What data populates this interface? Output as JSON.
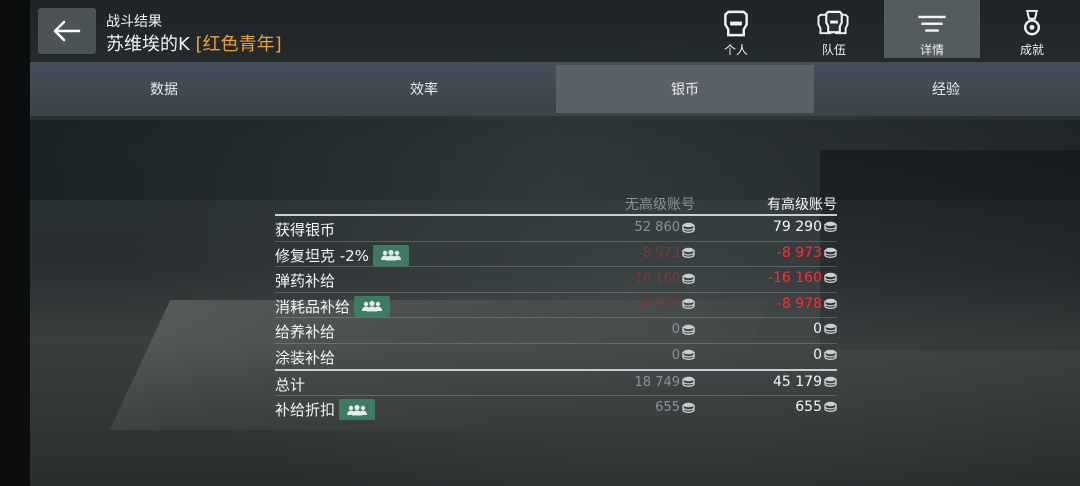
{
  "header": {
    "subtitle": "战斗结果",
    "player_name": "苏维埃的K",
    "clan_tag": "[红色青年]"
  },
  "topnav": [
    {
      "label": "个人",
      "icon": "player-helmet-icon",
      "active": false
    },
    {
      "label": "队伍",
      "icon": "team-helmets-icon",
      "active": false
    },
    {
      "label": "详情",
      "icon": "details-lines-icon",
      "active": true
    },
    {
      "label": "成就",
      "icon": "medal-icon",
      "active": false
    }
  ],
  "tabs": [
    {
      "label": "数据",
      "active": false
    },
    {
      "label": "效率",
      "active": false
    },
    {
      "label": "银币",
      "active": true
    },
    {
      "label": "经验",
      "active": false
    }
  ],
  "table": {
    "col_without_premium": "无高级账号",
    "col_with_premium": "有高级账号",
    "rows": [
      {
        "label": "获得银币",
        "without": "52 860",
        "with": "79 290",
        "negative": false,
        "squad": false
      },
      {
        "label": "修复坦克 -2%",
        "without": "-8 973",
        "with": "-8 973",
        "negative": true,
        "squad": true
      },
      {
        "label": "弹药补给",
        "without": "-16 160",
        "with": "-16 160",
        "negative": true,
        "squad": false
      },
      {
        "label": "消耗品补给",
        "without": "-8 978",
        "with": "-8 978",
        "negative": true,
        "squad": true
      },
      {
        "label": "给养补给",
        "without": "0",
        "with": "0",
        "negative": false,
        "squad": false
      },
      {
        "label": "涂装补给",
        "without": "0",
        "with": "0",
        "negative": false,
        "squad": false
      }
    ],
    "totals": [
      {
        "label": "总计",
        "without": "18 749",
        "with": "45 179",
        "squad": false
      },
      {
        "label": "补给折扣",
        "without": "655",
        "with": "655",
        "squad": true
      }
    ]
  },
  "colors": {
    "negative": "#ff2d2d",
    "clan_tag": "#f0a030",
    "squad_badge": "#3e7b63"
  }
}
